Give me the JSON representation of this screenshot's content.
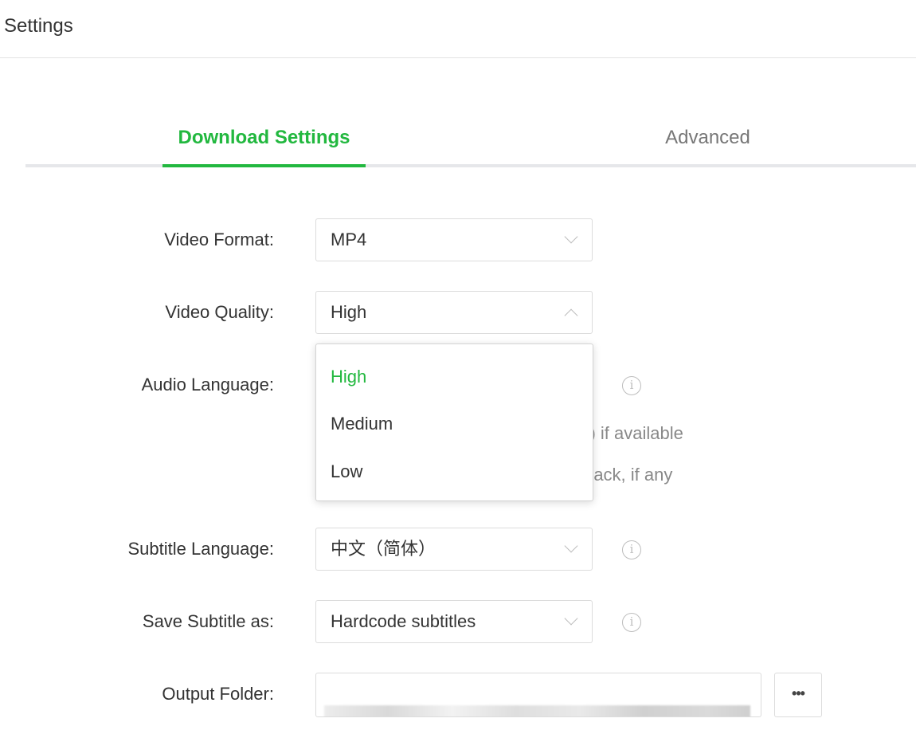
{
  "header": {
    "title": "Settings"
  },
  "tabs": [
    {
      "label": "Download Settings",
      "active": true
    },
    {
      "label": "Advanced",
      "active": false
    }
  ],
  "colors": {
    "accent": "#22b83f",
    "inactive_tab": "#777777",
    "text": "#333333",
    "muted": "#888888"
  },
  "form": {
    "video_format": {
      "label": "Video Format:",
      "value": "MP4",
      "icon": "chevron-down-icon"
    },
    "video_quality": {
      "label": "Video Quality:",
      "value": "High",
      "icon": "chevron-up-icon",
      "open": true,
      "options": [
        "High",
        "Medium",
        "Low"
      ],
      "selected": "High"
    },
    "audio_language": {
      "label": "Audio Language:",
      "info_icon": "info-icon",
      "partial_text_1": "on) if available",
      "partial_text_2": "rack, if any"
    },
    "subtitle_language": {
      "label": "Subtitle Language:",
      "value": "中文（简体）",
      "icon": "chevron-down-icon",
      "info_icon": "info-icon"
    },
    "save_subtitle_as": {
      "label": "Save Subtitle as:",
      "value": "Hardcode subtitles",
      "icon": "chevron-down-icon",
      "info_icon": "info-icon"
    },
    "output_folder": {
      "label": "Output Folder:",
      "browse_label": "•••"
    }
  }
}
